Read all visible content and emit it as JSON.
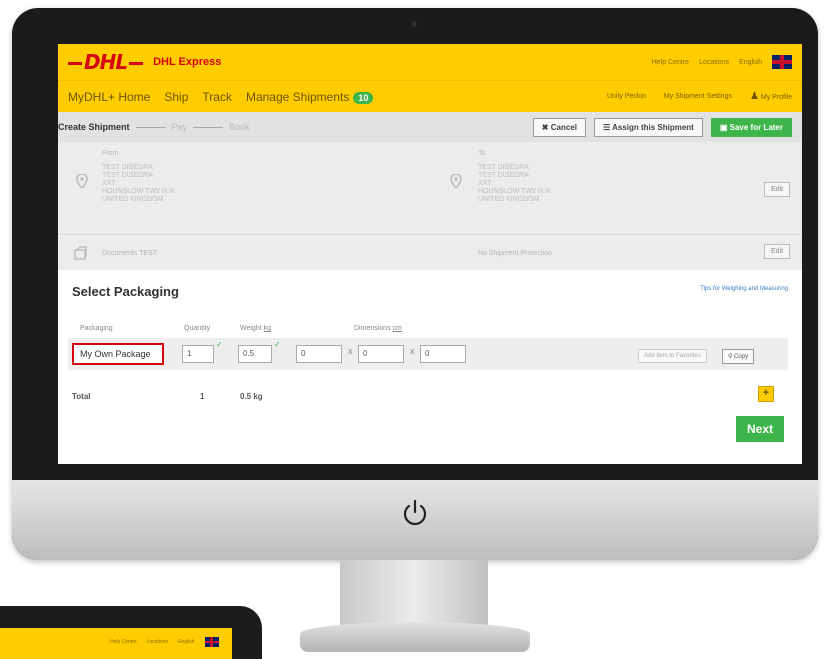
{
  "header": {
    "logo_text": "DHL",
    "brand": "DHL Express",
    "links": [
      "Help Centre",
      "Locations",
      "English"
    ]
  },
  "nav": {
    "items": [
      "MyDHL+ Home",
      "Ship",
      "Track",
      "Manage Shipments"
    ],
    "manage_badge": "10",
    "right_links": [
      "Unity Peckin",
      "My Shipment Settings",
      "My Profile"
    ]
  },
  "shipment": {
    "steps": [
      "Create Shipment",
      "Pay",
      "Book"
    ],
    "cancel_label": "Cancel",
    "assign_label": "Assign this Shipment",
    "save_label": "Save for Later"
  },
  "addresses": {
    "from_label": "From",
    "from_lines": "TEST DISEDRA\nTEST DISEDRA\nXXT\nHOUNSLOW TW2 6UK\nUNITED KINGDOM",
    "to_label": "To",
    "to_lines": "TEST DISEDRA\nTEST DISEDRA\nXXT\nHOUNSLOW TW2 6UK\nUNITED KINGDOM",
    "edit_label": "Edit",
    "documents": "Documents TEST",
    "protection": "No Shipment Protection",
    "edit2_label": "Edit"
  },
  "packaging": {
    "title": "Select Packaging",
    "tips": "Tips for Weighing and Measuring",
    "col_packaging": "Packaging",
    "col_quantity": "Quantity",
    "col_weight": "Weight",
    "weight_unit": "kg",
    "col_dimensions": "Dimensions",
    "dim_unit": "cm",
    "package_value": "My Own Package",
    "quantity": "1",
    "weight": "0.5",
    "dim1": "0",
    "dim2": "0",
    "dim3": "0",
    "x1": "X",
    "x2": "X",
    "add_favorites": "Add item to Favorites",
    "copy_label": "Copy",
    "total_label": "Total",
    "total_qty": "1",
    "total_weight": "0.5 kg",
    "add_symbol": "+",
    "next_label": "Next"
  },
  "second_monitor": {
    "links": [
      "Help Centre",
      "Locations",
      "English"
    ]
  },
  "colors": {
    "dhl_yellow": "#ffcc00",
    "dhl_red": "#d40511",
    "green": "#3db54a"
  }
}
